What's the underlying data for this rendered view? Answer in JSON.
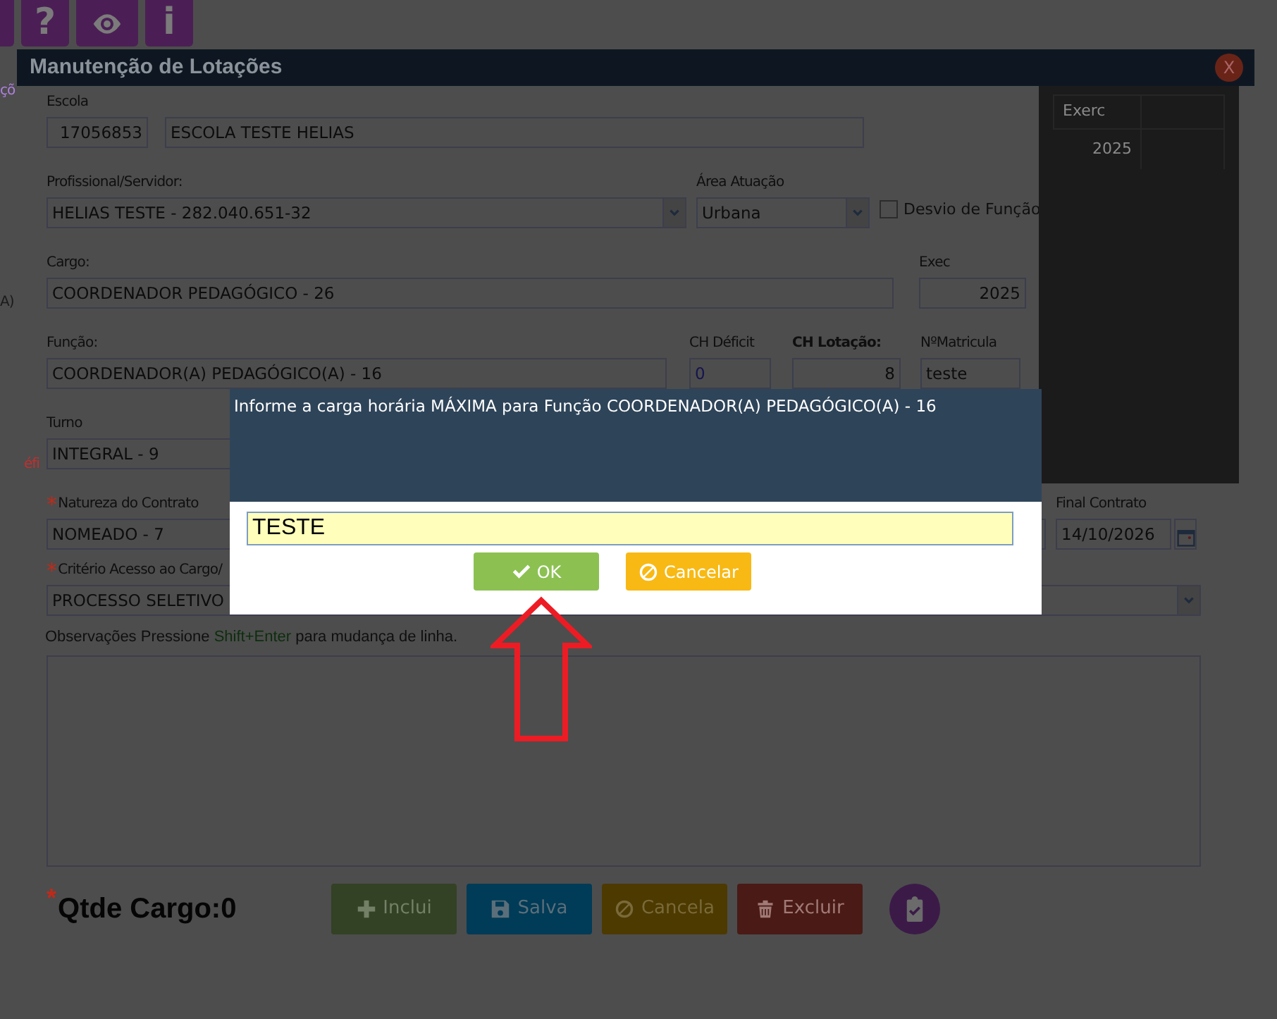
{
  "toolbar": {
    "buttons": [
      {
        "kind": "partial"
      },
      {
        "kind": "glyph",
        "glyph": "?"
      },
      {
        "kind": "eye"
      },
      {
        "kind": "glyph",
        "glyph": "i"
      }
    ]
  },
  "background_fragments": [
    {
      "kind": "link",
      "text": "çõ"
    },
    {
      "kind": "plain",
      "text": "A)"
    },
    {
      "kind": "alert",
      "text": "éfi"
    }
  ],
  "window": {
    "title": "Manutenção de Lotações",
    "close_label": "X"
  },
  "exercise_table": {
    "columns": [
      "Exerc"
    ],
    "rows": [
      [
        "2025"
      ]
    ]
  },
  "form": {
    "escola": {
      "label": "Escola",
      "code": "17056853",
      "name": "ESCOLA TESTE HELIAS"
    },
    "profissional": {
      "label": "Profissional/Servidor:",
      "value": "HELIAS TESTE - 282.040.651-32"
    },
    "area_atuacao": {
      "label": "Área Atuação",
      "value": "Urbana"
    },
    "desvio_funcao": {
      "label": "Desvio de Função",
      "checked": false
    },
    "cargo": {
      "label": "Cargo:",
      "value": "COORDENADOR PEDAGÓGICO - 26"
    },
    "exec": {
      "label": "Exec",
      "value": "2025"
    },
    "funcao": {
      "label": "Função:",
      "value": "COORDENADOR(A) PEDAGÓGICO(A) - 16"
    },
    "ch_deficit": {
      "label": "CH Déficit",
      "value": "0"
    },
    "ch_lotacao": {
      "label": "CH Lotação:",
      "value": "8"
    },
    "matricula": {
      "label": "NºMatricula",
      "value": "teste"
    },
    "turno": {
      "label": "Turno",
      "value": "INTEGRAL - 9"
    },
    "natureza": {
      "marker": "*",
      "label": "Natureza do Contrato",
      "value": "NOMEADO - 7"
    },
    "final_contrato": {
      "label": "Final Contrato",
      "value": "14/10/2026"
    },
    "criterio": {
      "marker": "*",
      "label": "Critério Acesso ao Cargo/",
      "value": "PROCESSO SELETIVO"
    },
    "observacoes": {
      "hint_parts": [
        "Observações Pressione",
        "Shift+Enter",
        "para mudança de linha."
      ]
    },
    "qtde": {
      "marker": "*",
      "label": "Qtde Cargo:0"
    }
  },
  "actions": [
    {
      "kind": "add",
      "label": "Inclui",
      "disabled": true
    },
    {
      "kind": "save",
      "label": "Salva",
      "disabled": false
    },
    {
      "kind": "cancel",
      "label": "Cancela",
      "disabled": false
    },
    {
      "kind": "delete",
      "label": "Excluir",
      "disabled": false
    },
    {
      "kind": "checklist"
    }
  ],
  "prompt": {
    "message": "Informe a carga horária MÁXIMA para Função COORDENADOR(A) PEDAGÓGICO(A) - 16",
    "value": "TESTE",
    "buttons": [
      {
        "kind": "ok",
        "label": "OK"
      },
      {
        "kind": "cancel",
        "label": "Cancelar"
      }
    ]
  }
}
